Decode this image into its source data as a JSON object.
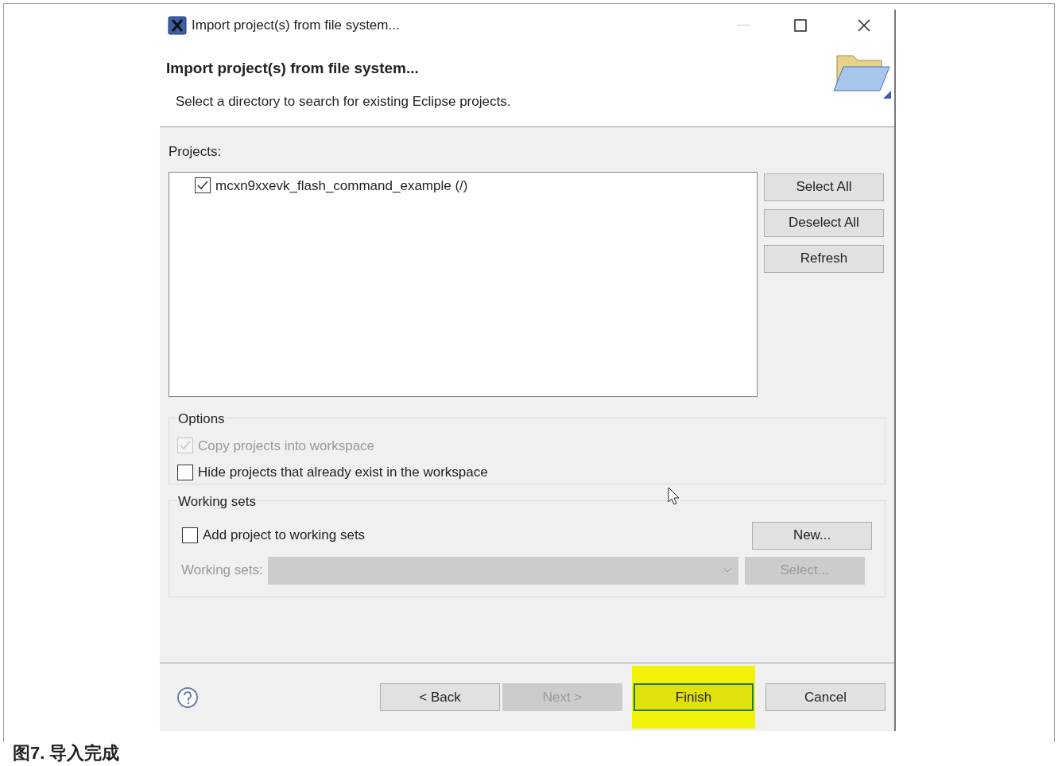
{
  "window": {
    "title": "Import project(s) from file system..."
  },
  "header": {
    "title": "Import project(s) from file system...",
    "subtitle": "Select a directory to search for existing Eclipse projects."
  },
  "projects": {
    "label": "Projects:",
    "items": [
      {
        "name": "mcxn9xxevk_flash_command_example (/)",
        "checked": true
      }
    ],
    "buttons": [
      {
        "label": "Select All",
        "disabled": false
      },
      {
        "label": "Deselect All",
        "disabled": false
      },
      {
        "label": "Refresh",
        "disabled": false
      }
    ]
  },
  "options": {
    "legend": "Options",
    "items": [
      {
        "label": "Copy projects into workspace",
        "checked": true,
        "disabled": true
      },
      {
        "label": "Hide projects that already exist in the workspace",
        "checked": false,
        "disabled": false
      }
    ]
  },
  "working_sets": {
    "legend": "Working sets",
    "add": {
      "label": "Add project to working sets",
      "checked": false
    },
    "new_button": {
      "label": "New...",
      "disabled": false
    },
    "field_label": "Working sets:",
    "field_disabled": true,
    "select_button": {
      "label": "Select...",
      "disabled": true
    }
  },
  "footer_buttons": [
    {
      "label": "< Back",
      "disabled": false,
      "highlighted": false
    },
    {
      "label": "Next >",
      "disabled": true,
      "highlighted": false
    },
    {
      "label": "Finish",
      "disabled": false,
      "highlighted": true
    },
    {
      "label": "Cancel",
      "disabled": false,
      "highlighted": false
    }
  ],
  "caption": "图7. 导入完成"
}
